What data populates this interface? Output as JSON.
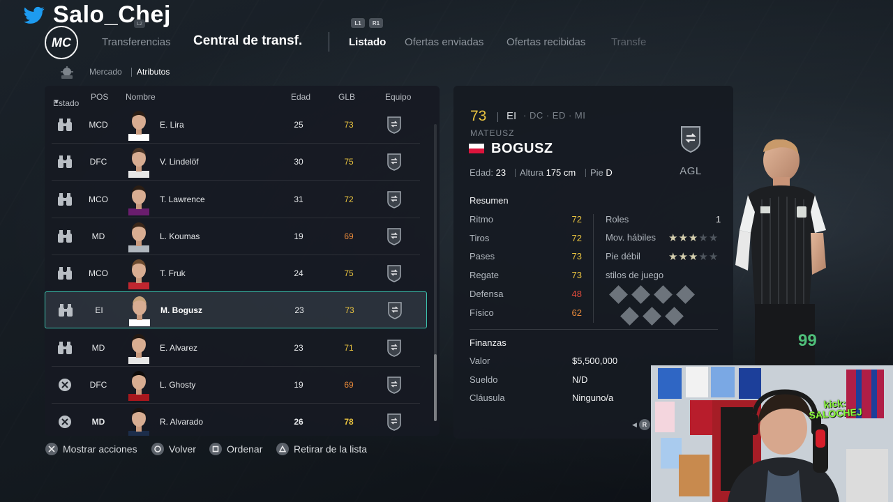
{
  "streamer": {
    "handle": "Salo_Chej",
    "icon": "twitter-bird-icon"
  },
  "nav": {
    "logo_text": "MC",
    "l2_hint": "L2",
    "transfers": "Transferencias",
    "title": "Central de transf.",
    "l1_hint": "L1",
    "r1_hint": "R1",
    "tabs": [
      {
        "label": "Listado",
        "active": true
      },
      {
        "label": "Ofertas enviadas",
        "active": false
      },
      {
        "label": "Ofertas recibidas",
        "active": false
      },
      {
        "label": "Transfe",
        "active": false
      }
    ],
    "sub": {
      "market": "Mercado",
      "attributes": "Atributos"
    }
  },
  "table": {
    "headers": {
      "status": "Estado",
      "sort_arrow": "▼",
      "pos": "POS",
      "name": "Nombre",
      "age": "Edad",
      "ovr": "GLB",
      "club": "Equipo"
    },
    "rows": [
      {
        "status": "binoculars",
        "pos": "MCD",
        "name": "E. Lira",
        "age": "25",
        "ovr": "73",
        "ovr_color": "#e9c33f"
      },
      {
        "status": "binoculars",
        "pos": "DFC",
        "name": "V. Lindelöf",
        "age": "30",
        "ovr": "75",
        "ovr_color": "#e9c33f"
      },
      {
        "status": "binoculars",
        "pos": "MCO",
        "name": "T. Lawrence",
        "age": "31",
        "ovr": "72",
        "ovr_color": "#e9c33f"
      },
      {
        "status": "binoculars",
        "pos": "MD",
        "name": "L. Koumas",
        "age": "19",
        "ovr": "69",
        "ovr_color": "#e8893a"
      },
      {
        "status": "binoculars",
        "pos": "MCO",
        "name": "T. Fruk",
        "age": "24",
        "ovr": "75",
        "ovr_color": "#e9c33f"
      },
      {
        "status": "binoculars",
        "pos": "EI",
        "name": "M. Bogusz",
        "age": "23",
        "ovr": "73",
        "ovr_color": "#e9c33f",
        "selected": true
      },
      {
        "status": "binoculars",
        "pos": "MD",
        "name": "E. Alvarez",
        "age": "23",
        "ovr": "71",
        "ovr_color": "#e9c33f"
      },
      {
        "status": "cross",
        "pos": "DFC",
        "name": "L. Ghosty",
        "age": "19",
        "ovr": "69",
        "ovr_color": "#e8893a"
      },
      {
        "status": "cross",
        "pos": "MD",
        "name": "R. Alvarado",
        "age": "26",
        "ovr": "78",
        "ovr_color": "#e9c33f"
      }
    ]
  },
  "detail": {
    "ovr": "73",
    "position": "EI",
    "alt_positions": "· DC · ED · MI",
    "first_name": "MATEUSZ",
    "last_name": "BOGUSZ",
    "nation_flag": "poland-flag",
    "club": "AGL",
    "age_label": "Edad:",
    "age": "23",
    "height_label": "Altura",
    "height": "175 cm",
    "foot_label": "Pie",
    "foot": "D",
    "summary_title": "Resumen",
    "stats": [
      {
        "label": "Ritmo",
        "value": "72",
        "color": "#e9c33f"
      },
      {
        "label": "Tiros",
        "value": "72",
        "color": "#e9c33f"
      },
      {
        "label": "Pases",
        "value": "73",
        "color": "#e9c33f"
      },
      {
        "label": "Regate",
        "value": "73",
        "color": "#e9c33f"
      },
      {
        "label": "Defensa",
        "value": "48",
        "color": "#e04b3c"
      },
      {
        "label": "Físico",
        "value": "62",
        "color": "#e8893a"
      }
    ],
    "roles_label": "Roles",
    "roles_value": "1",
    "skill_label": "Mov. hábiles",
    "skill_stars": 3,
    "weak_label": "Pie débil",
    "weak_stars": 3,
    "star_total": 5,
    "playstyles_label": "stilos de juego",
    "finance_title": "Finanzas",
    "value_label": "Valor",
    "value": "$5,500,000",
    "wage_label": "Sueldo",
    "wage": "N/D",
    "clause_label": "Cláusula",
    "clause": "Ninguno/a",
    "r_hint": "R",
    "kit_number": "99"
  },
  "actions": [
    {
      "button": "cross",
      "label": "Mostrar acciones"
    },
    {
      "button": "circle",
      "label": "Volver"
    },
    {
      "button": "square",
      "label": "Ordenar"
    },
    {
      "button": "triangle",
      "label": "Retirar de la lista"
    }
  ],
  "webcam": {
    "overlay_text_line1": "kick:",
    "overlay_text_line2": "SALOCHEJ"
  },
  "colors": {
    "accent_teal": "#3cc4b0",
    "gold": "#e9c33f",
    "orange": "#e8893a",
    "red": "#e04b3c"
  }
}
